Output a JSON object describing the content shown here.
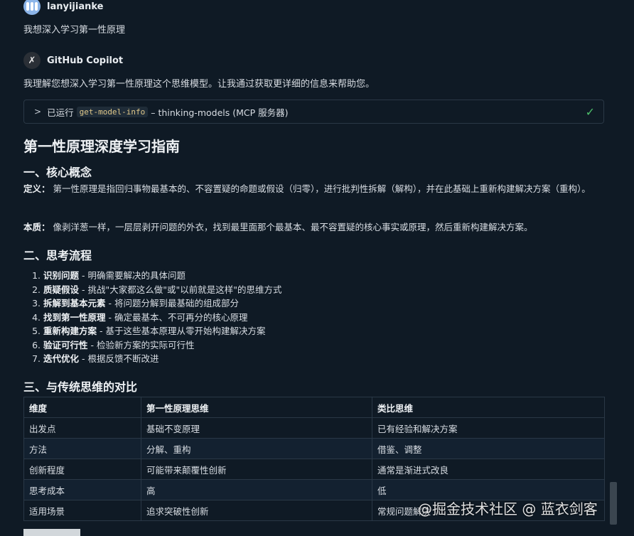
{
  "user": {
    "name": "lanyijianke",
    "message": "我想深入学习第一性原理"
  },
  "bot": {
    "name": "GitHub Copilot",
    "intro": "我理解您想深入学习第一性原理这个思维模型。让我通过获取更详细的信息来帮助您。",
    "tool": {
      "prefix": "已运行",
      "code": "get-model-info",
      "suffix": "– thinking-models (MCP 服务器)"
    }
  },
  "doc": {
    "title": "第一性原理深度学习指南",
    "sec1": {
      "heading": "一、核心概念",
      "def_label": "定义：",
      "def_text": "第一性原理是指回归事物最基本的、不容置疑的命题或假设（归零），进行批判性拆解（解构），并在此基础上重新构建解决方案（重构）。",
      "essence_label": "本质：",
      "essence_text": "像剥洋葱一样，一层层剥开问题的外衣，找到最里面那个最基本、最不容置疑的核心事实或原理，然后重新构建解决方案。"
    },
    "sec2": {
      "heading": "二、思考流程",
      "steps": [
        {
          "name": "识别问题",
          "desc": " - 明确需要解决的具体问题"
        },
        {
          "name": "质疑假设",
          "desc": " - 挑战\"大家都这么做\"或\"以前就是这样\"的思维方式"
        },
        {
          "name": "拆解到基本元素",
          "desc": " - 将问题分解到最基础的组成部分"
        },
        {
          "name": "找到第一性原理",
          "desc": " - 确定最基本、不可再分的核心原理"
        },
        {
          "name": "重新构建方案",
          "desc": " - 基于这些基本原理从零开始构建解决方案"
        },
        {
          "name": "验证可行性",
          "desc": " - 检验新方案的实际可行性"
        },
        {
          "name": "迭代优化",
          "desc": " - 根据反馈不断改进"
        }
      ]
    },
    "sec3": {
      "heading": "三、与传统思维的对比",
      "headers": [
        "维度",
        "第一性原理思维",
        "类比思维"
      ],
      "rows": [
        [
          "出发点",
          "基础不变原理",
          "已有经验和解决方案"
        ],
        [
          "方法",
          "分解、重构",
          "借鉴、调整"
        ],
        [
          "创新程度",
          "可能带来颠覆性创新",
          "通常是渐进式改良"
        ],
        [
          "思考成本",
          "高",
          "低"
        ],
        [
          "适用场景",
          "追求突破性创新",
          "常规问题解决"
        ]
      ]
    }
  },
  "watermark": "@掘金技术社区 @ 蓝衣剑客"
}
